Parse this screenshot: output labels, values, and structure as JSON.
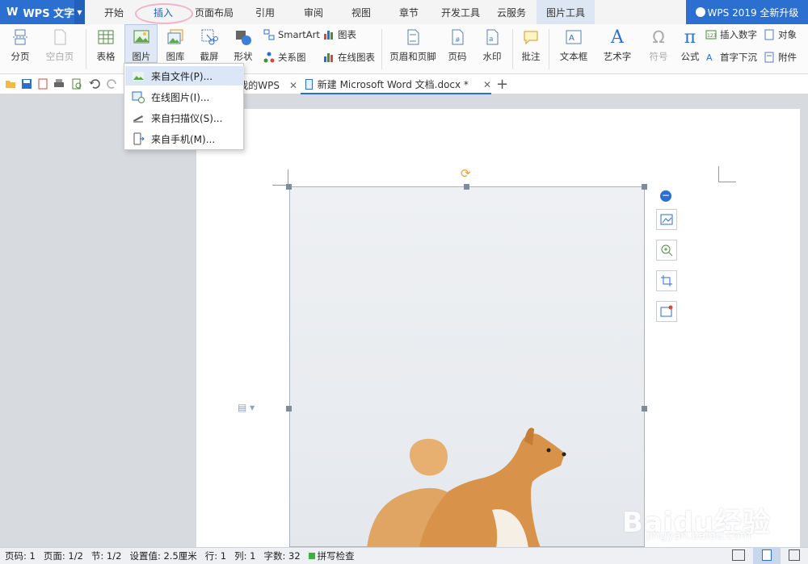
{
  "app": {
    "logo": "WPS 文字",
    "upgrade": "WPS 2019 全新升级"
  },
  "tabs": [
    "开始",
    "插入",
    "页面布局",
    "引用",
    "审阅",
    "视图",
    "章节",
    "开发工具",
    "云服务",
    "图片工具"
  ],
  "active_tab": "插入",
  "ribbon": {
    "page_break": "分页",
    "blank_page": "空白页",
    "table": "表格",
    "picture": "图片",
    "gallery": "图库",
    "screenshot": "截屏",
    "shape": "形状",
    "smartart": "SmartArt",
    "chart": "图表",
    "relation": "关系图",
    "online_chart": "在线图表",
    "header_footer": "页眉和页脚",
    "page_number": "页码",
    "watermark": "水印",
    "comment": "批注",
    "textbox": "文本框",
    "wordart": "艺术字",
    "symbol": "符号",
    "formula": "公式",
    "insert_number": "插入数字",
    "object": "对象",
    "dropcap": "首字下沉",
    "attachment": "附件"
  },
  "doc_tabs": {
    "mywps": "我的WPS",
    "active": "新建 Microsoft Word 文档.docx *"
  },
  "menu": {
    "items": [
      "来自文件(P)...",
      "在线图片(I)...",
      "来自扫描仪(S)...",
      "来自手机(M)..."
    ]
  },
  "status": {
    "page": "页码: 1",
    "pages": "页面: 1/2",
    "section": "节: 1/2",
    "setting": "设置值: 2.5厘米",
    "row": "行: 1",
    "col": "列: 1",
    "words": "字数: 32",
    "spell": "拼写检查"
  },
  "watermark": {
    "text": "Baidu经验",
    "url": "jingyan.baidu.com"
  },
  "colors": {
    "accent": "#2b6fd0",
    "highlight": "#dbe6f6",
    "ring": "#f0b3c8"
  }
}
